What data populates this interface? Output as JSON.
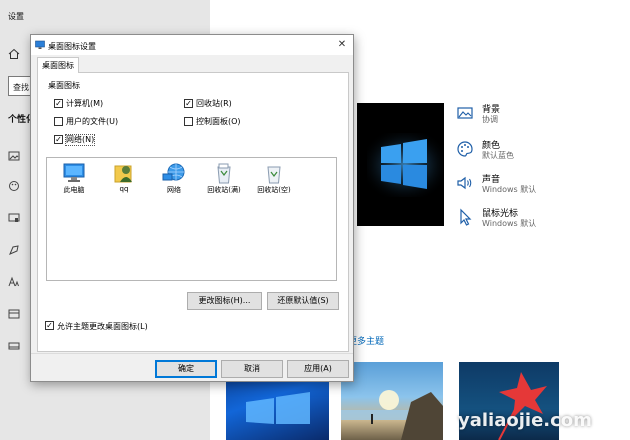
{
  "top_crop": "(cropped title text)",
  "settings": {
    "title": "设置",
    "search_value": "查找",
    "section": "个性化",
    "side_items": [
      {
        "title": "背景",
        "sub": "协调"
      },
      {
        "title": "颜色",
        "sub": "默认蓝色"
      },
      {
        "title": "声音",
        "sub": "Windows 默认"
      },
      {
        "title": "鼠标光标",
        "sub": "Windows 默认"
      }
    ],
    "more_themes": "更多主题"
  },
  "dialog": {
    "title": "桌面图标设置",
    "close_glyph": "✕",
    "tab": "桌面图标",
    "group_label": "桌面图标",
    "checkboxes": [
      {
        "label": "计算机(M)",
        "checked": true
      },
      {
        "label": "回收站(R)",
        "checked": true
      },
      {
        "label": "用户的文件(U)",
        "checked": false
      },
      {
        "label": "控制面板(O)",
        "checked": false
      },
      {
        "label": "网络(N)",
        "checked": true
      }
    ],
    "icons": [
      {
        "label": "此电脑",
        "icon": "computer-icon"
      },
      {
        "label": "qq",
        "icon": "user-folder-icon"
      },
      {
        "label": "网络",
        "icon": "network-icon"
      },
      {
        "label": "回收站(满)",
        "icon": "recycle-bin-full-icon"
      },
      {
        "label": "回收站(空)",
        "icon": "recycle-bin-empty-icon"
      }
    ],
    "change_icon_button": "更改图标(H)...",
    "restore_default_button": "还原默认值(S)",
    "allow_themes_label": "允许主题更改桌面图标(L)",
    "allow_themes_checked": true,
    "ok_button": "确定",
    "cancel_button": "取消",
    "apply_button": "应用(A)"
  },
  "watermark": "yaliaojie.com",
  "colors": {
    "link": "#0067b8",
    "accent": "#0078d7"
  }
}
